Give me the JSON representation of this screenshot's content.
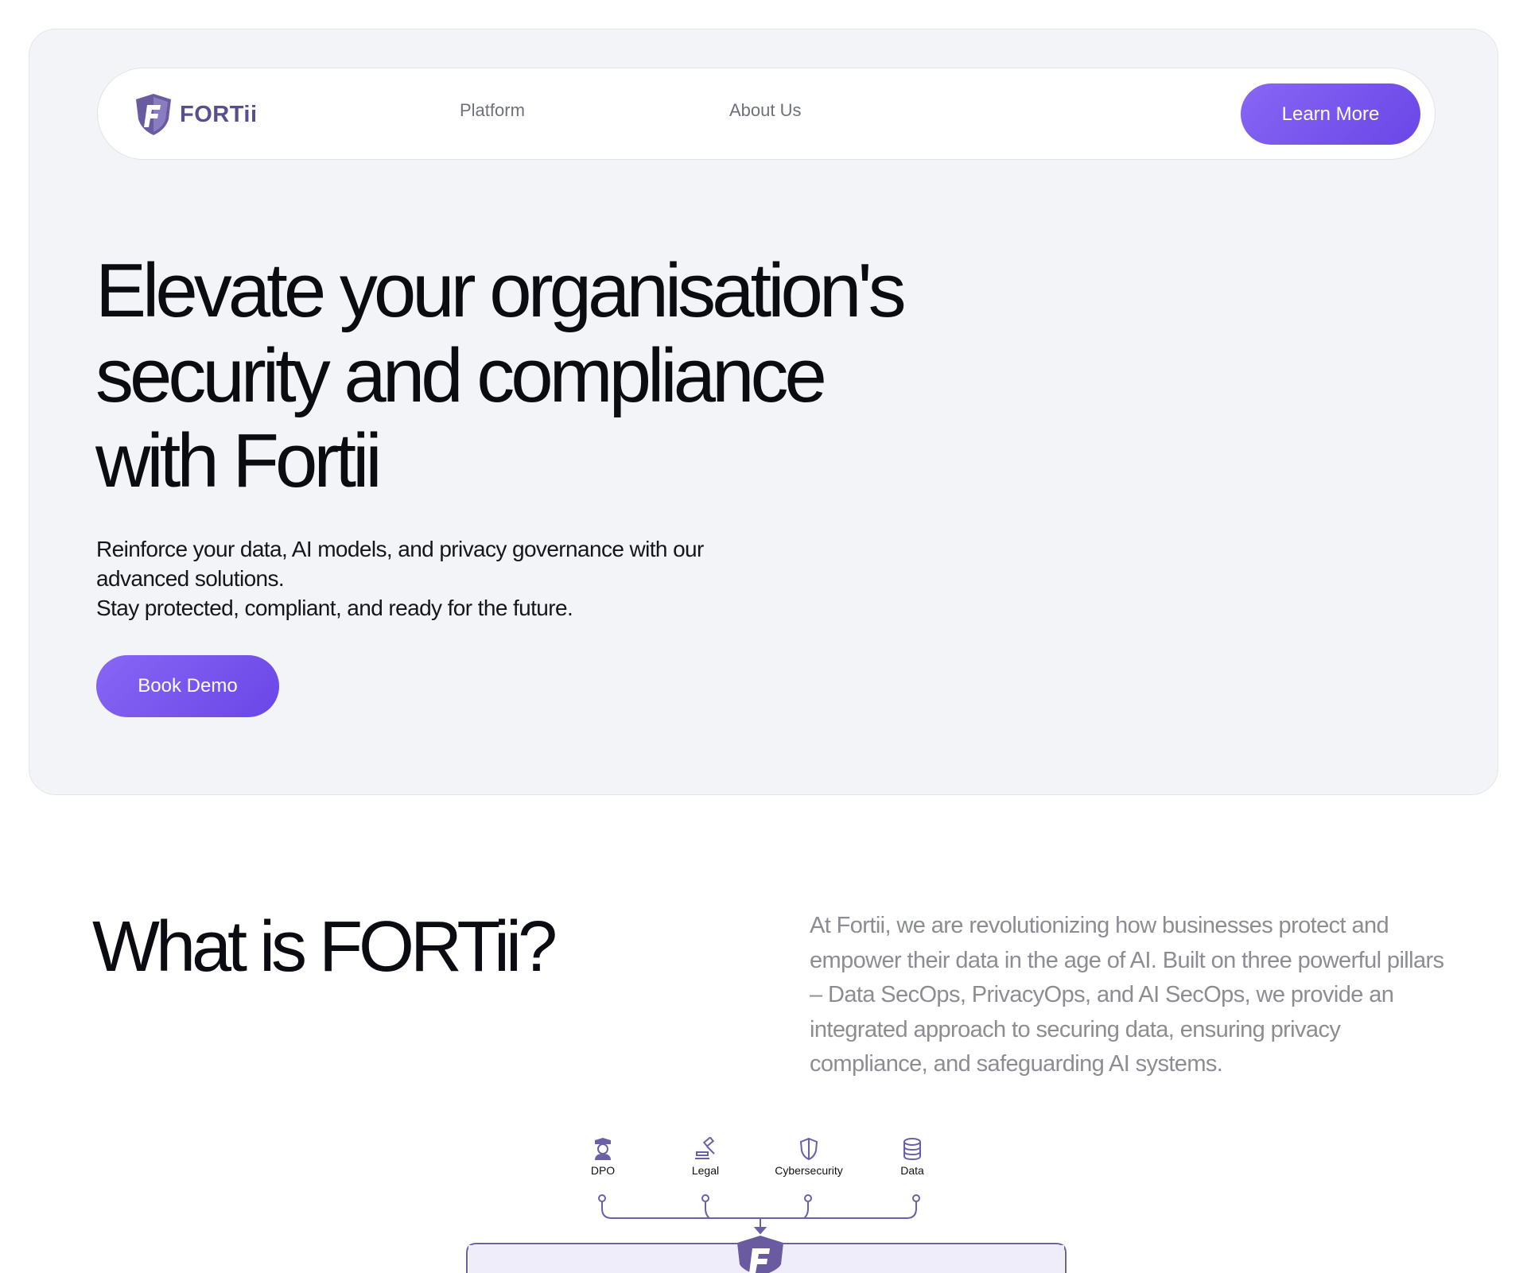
{
  "nav": {
    "logo_text": "FORTii",
    "links": [
      "Platform",
      "About Us"
    ],
    "cta_label": "Learn More"
  },
  "hero": {
    "title_lines": [
      "Elevate your organisation's",
      "security and compliance",
      "with Fortii"
    ],
    "subtitle_lines": [
      "Reinforce your data, AI models, and privacy governance with our",
      "advanced solutions.",
      "Stay protected, compliant, and ready for the future."
    ],
    "cta_label": "Book Demo"
  },
  "about": {
    "heading": "What is FORTii?",
    "description": "At Fortii, we are revolutionizing how businesses protect and empower their data in the age of AI. Built on three powerful pillars – Data SecOps, PrivacyOps, and AI SecOps, we provide an integrated approach to securing data, ensuring privacy compliance, and safeguarding AI systems."
  },
  "diagram": {
    "pillars": [
      {
        "label": "DPO",
        "icon": "officer-icon"
      },
      {
        "label": "Legal",
        "icon": "gavel-icon"
      },
      {
        "label": "Cybersecurity",
        "icon": "shield-icon"
      },
      {
        "label": "Data",
        "icon": "database-icon"
      }
    ]
  },
  "colors": {
    "accent": "#7554ee",
    "brand": "#5b4e8f",
    "hero_bg": "#f3f4f7",
    "muted_text": "#8c8d93"
  }
}
